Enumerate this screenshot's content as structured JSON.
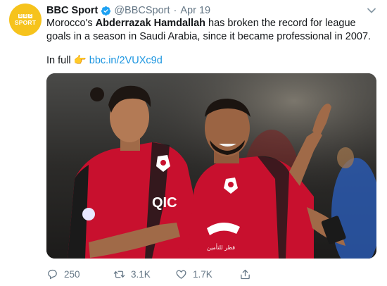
{
  "tweet": {
    "display_name": "BBC Sport",
    "handle": "@BBCSport",
    "separator": "·",
    "date": "Apr 19",
    "avatar_logo": [
      "B",
      "B",
      "C"
    ],
    "avatar_word": "SPORT",
    "text_before": "Morocco's ",
    "text_bold": "Abderrazak Hamdallah",
    "text_after": " has broken the record for league goals in a season in Saudi Arabia, since it became professional in 2007.",
    "in_full_label": "In full",
    "in_full_emoji": "👉",
    "link_text": "bbc.in/2VUXc9d",
    "shirt_sponsor": "QIC",
    "shirt_sponsor_sub": "قطر للتأمين"
  },
  "actions": {
    "replies": "250",
    "retweets": "3.1K",
    "likes": "1.7K"
  },
  "colors": {
    "link": "#1b95e0",
    "verified": "#1da1f2",
    "muted": "#657786",
    "avatar_bg": "#f6c31c",
    "kit_red": "#c8102e"
  },
  "icons": [
    "verified-badge-icon",
    "chevron-down-icon",
    "pointing-right-emoji",
    "reply-icon",
    "retweet-icon",
    "like-icon",
    "share-icon"
  ]
}
